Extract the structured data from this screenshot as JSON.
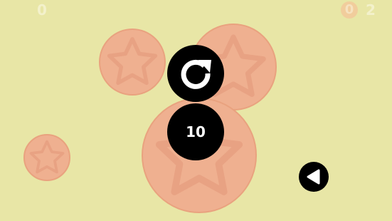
{
  "colors": {
    "background": "#E8E6A6",
    "bubble_fill": "#EFB090",
    "bubble_stroke": "#E9A27F",
    "bubble_star": "#E8A283",
    "hud_text": "#F3F1CB",
    "coin": "#F1CD9C",
    "coin_text": "#F6E2BF",
    "button_fill": "#000000",
    "button_icon": "#FFFFFF"
  },
  "hud": {
    "score": "0",
    "coins": "2",
    "coin_glyph": "0",
    "coin_icon": "coin-icon"
  },
  "buttons": {
    "restart_icon": "restart-arrow-icon",
    "level_label": "10",
    "back_icon": "triangle-left-icon"
  },
  "bubbles": [
    {
      "name": "bubble-top-left",
      "icon": "star-icon"
    },
    {
      "name": "bubble-top-right",
      "icon": "star-icon"
    },
    {
      "name": "bubble-bottom-center",
      "icon": "star-icon"
    },
    {
      "name": "bubble-small-left",
      "icon": "star-icon"
    }
  ]
}
